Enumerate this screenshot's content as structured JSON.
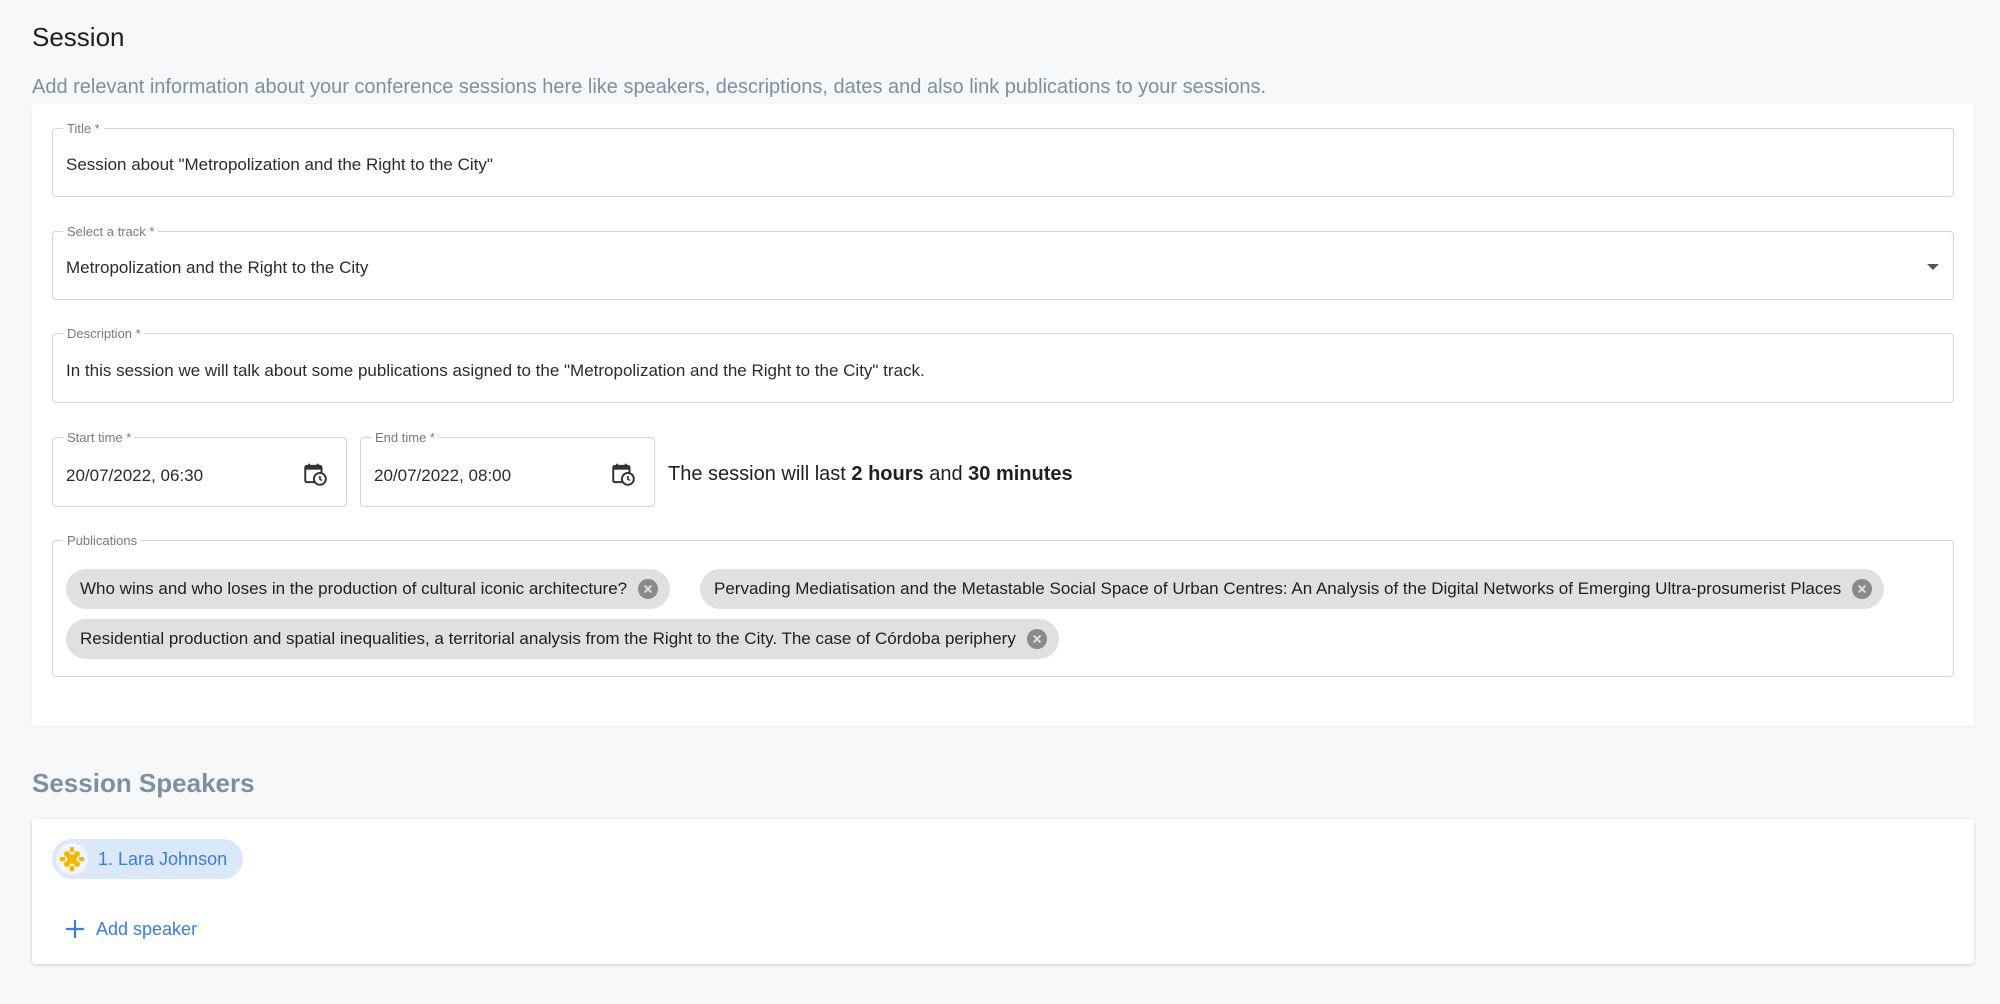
{
  "header": {
    "title": "Session",
    "subtitle": "Add relevant information about your conference sessions here like speakers, descriptions, dates and also link publications to your sessions."
  },
  "form": {
    "title": {
      "label": "Title *",
      "value": "Session about \"Metropolization and the Right to the City\""
    },
    "track": {
      "label": "Select a track *",
      "value": "Metropolization and the Right to the City"
    },
    "description": {
      "label": "Description *",
      "value": "In this session we will talk about some publications asigned to the \"Metropolization and the Right to the City\" track."
    },
    "start_time": {
      "label": "Start time *",
      "value": "20/07/2022, 06:30",
      "icon": "calendar-clock-icon"
    },
    "end_time": {
      "label": "End time *",
      "value": "20/07/2022, 08:00",
      "icon": "calendar-clock-icon"
    },
    "duration": {
      "prefix": "The session will last",
      "hours": "2 hours",
      "joiner": "and",
      "minutes": "30 minutes"
    },
    "publications": {
      "label": "Publications",
      "items": [
        "Who wins and who loses in the production of cultural iconic architecture?",
        "Pervading Mediatisation and the Metastable Social Space of Urban Centres: An Analysis of the Digital Networks of Emerging Ultra-prosumerist Places",
        "Residential production and spatial inequalities, a territorial analysis from the Right to the City. The case of Córdoba periphery"
      ]
    }
  },
  "speakers": {
    "title": "Session Speakers",
    "items": [
      {
        "label": "1. Lara Johnson",
        "avatar": "yellow-identicon"
      }
    ],
    "add_label": "Add speaker"
  },
  "colors": {
    "accent": "#3b7ddd",
    "muted_text": "#7d8fa3",
    "chip_bg": "#e0e0e0",
    "speaker_chip_bg": "#dbe7fb",
    "avatar_color": "#f2b705"
  }
}
